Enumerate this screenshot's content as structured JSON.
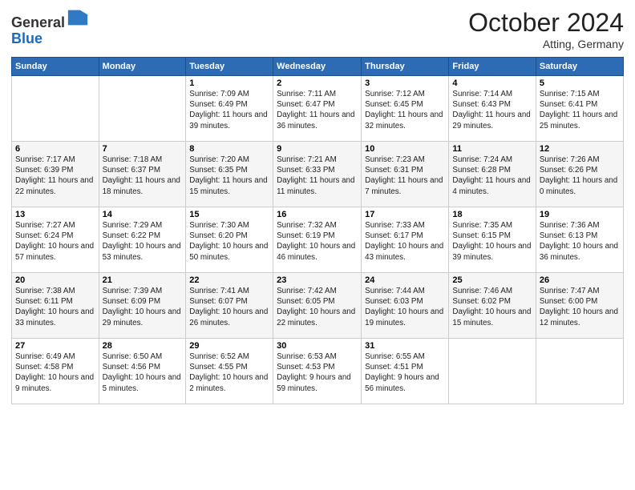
{
  "header": {
    "logo_general": "General",
    "logo_blue": "Blue",
    "month": "October 2024",
    "location": "Atting, Germany"
  },
  "weekdays": [
    "Sunday",
    "Monday",
    "Tuesday",
    "Wednesday",
    "Thursday",
    "Friday",
    "Saturday"
  ],
  "weeks": [
    [
      {
        "day": "",
        "sunrise": "",
        "sunset": "",
        "daylight": ""
      },
      {
        "day": "",
        "sunrise": "",
        "sunset": "",
        "daylight": ""
      },
      {
        "day": "1",
        "sunrise": "Sunrise: 7:09 AM",
        "sunset": "Sunset: 6:49 PM",
        "daylight": "Daylight: 11 hours and 39 minutes."
      },
      {
        "day": "2",
        "sunrise": "Sunrise: 7:11 AM",
        "sunset": "Sunset: 6:47 PM",
        "daylight": "Daylight: 11 hours and 36 minutes."
      },
      {
        "day": "3",
        "sunrise": "Sunrise: 7:12 AM",
        "sunset": "Sunset: 6:45 PM",
        "daylight": "Daylight: 11 hours and 32 minutes."
      },
      {
        "day": "4",
        "sunrise": "Sunrise: 7:14 AM",
        "sunset": "Sunset: 6:43 PM",
        "daylight": "Daylight: 11 hours and 29 minutes."
      },
      {
        "day": "5",
        "sunrise": "Sunrise: 7:15 AM",
        "sunset": "Sunset: 6:41 PM",
        "daylight": "Daylight: 11 hours and 25 minutes."
      }
    ],
    [
      {
        "day": "6",
        "sunrise": "Sunrise: 7:17 AM",
        "sunset": "Sunset: 6:39 PM",
        "daylight": "Daylight: 11 hours and 22 minutes."
      },
      {
        "day": "7",
        "sunrise": "Sunrise: 7:18 AM",
        "sunset": "Sunset: 6:37 PM",
        "daylight": "Daylight: 11 hours and 18 minutes."
      },
      {
        "day": "8",
        "sunrise": "Sunrise: 7:20 AM",
        "sunset": "Sunset: 6:35 PM",
        "daylight": "Daylight: 11 hours and 15 minutes."
      },
      {
        "day": "9",
        "sunrise": "Sunrise: 7:21 AM",
        "sunset": "Sunset: 6:33 PM",
        "daylight": "Daylight: 11 hours and 11 minutes."
      },
      {
        "day": "10",
        "sunrise": "Sunrise: 7:23 AM",
        "sunset": "Sunset: 6:31 PM",
        "daylight": "Daylight: 11 hours and 7 minutes."
      },
      {
        "day": "11",
        "sunrise": "Sunrise: 7:24 AM",
        "sunset": "Sunset: 6:28 PM",
        "daylight": "Daylight: 11 hours and 4 minutes."
      },
      {
        "day": "12",
        "sunrise": "Sunrise: 7:26 AM",
        "sunset": "Sunset: 6:26 PM",
        "daylight": "Daylight: 11 hours and 0 minutes."
      }
    ],
    [
      {
        "day": "13",
        "sunrise": "Sunrise: 7:27 AM",
        "sunset": "Sunset: 6:24 PM",
        "daylight": "Daylight: 10 hours and 57 minutes."
      },
      {
        "day": "14",
        "sunrise": "Sunrise: 7:29 AM",
        "sunset": "Sunset: 6:22 PM",
        "daylight": "Daylight: 10 hours and 53 minutes."
      },
      {
        "day": "15",
        "sunrise": "Sunrise: 7:30 AM",
        "sunset": "Sunset: 6:20 PM",
        "daylight": "Daylight: 10 hours and 50 minutes."
      },
      {
        "day": "16",
        "sunrise": "Sunrise: 7:32 AM",
        "sunset": "Sunset: 6:19 PM",
        "daylight": "Daylight: 10 hours and 46 minutes."
      },
      {
        "day": "17",
        "sunrise": "Sunrise: 7:33 AM",
        "sunset": "Sunset: 6:17 PM",
        "daylight": "Daylight: 10 hours and 43 minutes."
      },
      {
        "day": "18",
        "sunrise": "Sunrise: 7:35 AM",
        "sunset": "Sunset: 6:15 PM",
        "daylight": "Daylight: 10 hours and 39 minutes."
      },
      {
        "day": "19",
        "sunrise": "Sunrise: 7:36 AM",
        "sunset": "Sunset: 6:13 PM",
        "daylight": "Daylight: 10 hours and 36 minutes."
      }
    ],
    [
      {
        "day": "20",
        "sunrise": "Sunrise: 7:38 AM",
        "sunset": "Sunset: 6:11 PM",
        "daylight": "Daylight: 10 hours and 33 minutes."
      },
      {
        "day": "21",
        "sunrise": "Sunrise: 7:39 AM",
        "sunset": "Sunset: 6:09 PM",
        "daylight": "Daylight: 10 hours and 29 minutes."
      },
      {
        "day": "22",
        "sunrise": "Sunrise: 7:41 AM",
        "sunset": "Sunset: 6:07 PM",
        "daylight": "Daylight: 10 hours and 26 minutes."
      },
      {
        "day": "23",
        "sunrise": "Sunrise: 7:42 AM",
        "sunset": "Sunset: 6:05 PM",
        "daylight": "Daylight: 10 hours and 22 minutes."
      },
      {
        "day": "24",
        "sunrise": "Sunrise: 7:44 AM",
        "sunset": "Sunset: 6:03 PM",
        "daylight": "Daylight: 10 hours and 19 minutes."
      },
      {
        "day": "25",
        "sunrise": "Sunrise: 7:46 AM",
        "sunset": "Sunset: 6:02 PM",
        "daylight": "Daylight: 10 hours and 15 minutes."
      },
      {
        "day": "26",
        "sunrise": "Sunrise: 7:47 AM",
        "sunset": "Sunset: 6:00 PM",
        "daylight": "Daylight: 10 hours and 12 minutes."
      }
    ],
    [
      {
        "day": "27",
        "sunrise": "Sunrise: 6:49 AM",
        "sunset": "Sunset: 4:58 PM",
        "daylight": "Daylight: 10 hours and 9 minutes."
      },
      {
        "day": "28",
        "sunrise": "Sunrise: 6:50 AM",
        "sunset": "Sunset: 4:56 PM",
        "daylight": "Daylight: 10 hours and 5 minutes."
      },
      {
        "day": "29",
        "sunrise": "Sunrise: 6:52 AM",
        "sunset": "Sunset: 4:55 PM",
        "daylight": "Daylight: 10 hours and 2 minutes."
      },
      {
        "day": "30",
        "sunrise": "Sunrise: 6:53 AM",
        "sunset": "Sunset: 4:53 PM",
        "daylight": "Daylight: 9 hours and 59 minutes."
      },
      {
        "day": "31",
        "sunrise": "Sunrise: 6:55 AM",
        "sunset": "Sunset: 4:51 PM",
        "daylight": "Daylight: 9 hours and 56 minutes."
      },
      {
        "day": "",
        "sunrise": "",
        "sunset": "",
        "daylight": ""
      },
      {
        "day": "",
        "sunrise": "",
        "sunset": "",
        "daylight": ""
      }
    ]
  ]
}
